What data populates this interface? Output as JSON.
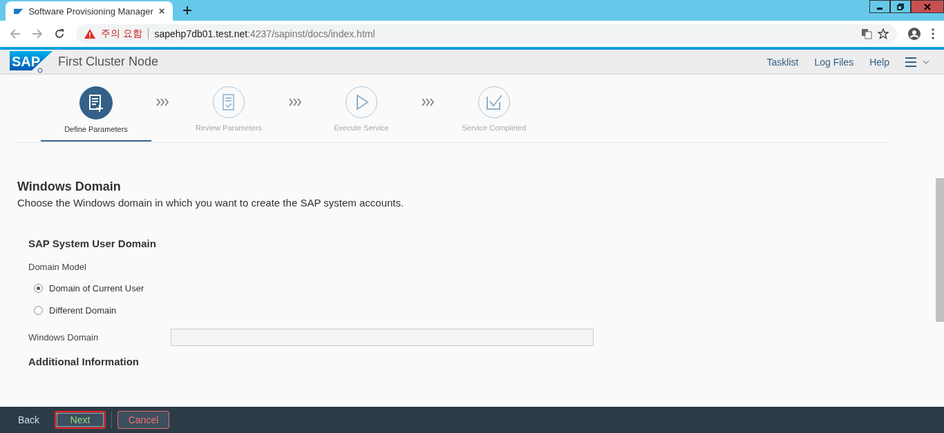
{
  "browser": {
    "tab_title": "Software Provisioning Manager",
    "warning": "주의 요함",
    "url_host": "sapehp7db01.test.net",
    "url_path": ":4237/sapinst/docs/index.html"
  },
  "header": {
    "logo": "SAP",
    "title": "First Cluster Node",
    "links": [
      "Tasklist",
      "Log Files",
      "Help"
    ]
  },
  "steps": [
    {
      "label": "Define Parameters",
      "kind": "define",
      "selected": true
    },
    {
      "label": "Review Parameters",
      "kind": "review",
      "selected": false
    },
    {
      "label": "Execute Service",
      "kind": "execute",
      "selected": false
    },
    {
      "label": "Service Completed",
      "kind": "completed",
      "selected": false
    }
  ],
  "section": {
    "title": "Windows Domain",
    "description": "Choose the Windows domain in which you want to create the SAP system accounts."
  },
  "group": {
    "title": "SAP System User Domain",
    "field_label": "Domain Model",
    "options": [
      {
        "label": "Domain of Current User",
        "selected": true
      },
      {
        "label": "Different Domain",
        "selected": false
      }
    ],
    "domain_label": "Windows Domain",
    "additional": "Additional Information"
  },
  "footer": {
    "back": "Back",
    "next": "Next",
    "cancel": "Cancel"
  }
}
